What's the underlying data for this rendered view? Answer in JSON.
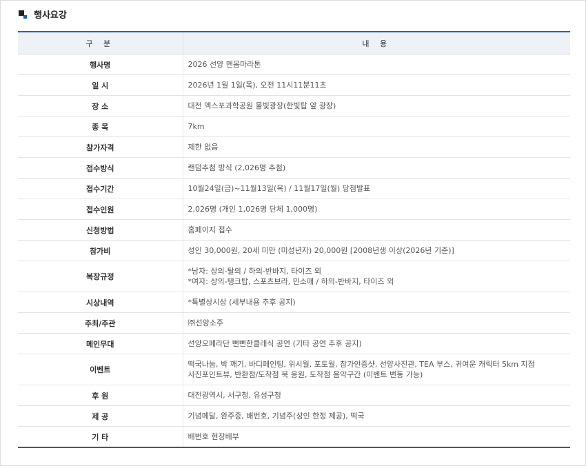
{
  "section": {
    "title": "행사요강"
  },
  "table": {
    "headers": [
      "구 분",
      "내 용"
    ],
    "rows": [
      {
        "label": "행사명",
        "value": [
          "2026 선양 맨몸마라톤"
        ]
      },
      {
        "label": "일 시",
        "value": [
          "2026년 1월 1일(목), 오전 11시11분11초"
        ]
      },
      {
        "label": "장 소",
        "value": [
          "대전 엑스포과학공원 물빛광장(한빛탑 앞 광장)"
        ]
      },
      {
        "label": "종 목",
        "value": [
          "7km"
        ]
      },
      {
        "label": "참가자격",
        "value": [
          "제한 없음"
        ]
      },
      {
        "label": "접수방식",
        "value": [
          "랜덤추첨 방식 (2,026명 추첨)"
        ]
      },
      {
        "label": "접수기간",
        "value": [
          "10월24일(금)~11월13일(목) / 11월17일(월) 당첨발표"
        ]
      },
      {
        "label": "접수인원",
        "value": [
          "2,026명 (개인 1,026명 단체 1,000명)"
        ]
      },
      {
        "label": "신청방법",
        "value": [
          "홈페이지 접수"
        ]
      },
      {
        "label": "참가비",
        "value": [
          "성인 30,000원, 20세 미만 (미성년자) 20,000원 [2008년생 이상(2026년 기준)]"
        ]
      },
      {
        "label": "복장규정",
        "value": [
          "*남자: 상의-탈의 / 하의-반바지, 타이즈 외",
          "*여자: 상의-탱크탑, 스포츠브라, 민소매 / 하의-반바지, 타이즈 외"
        ]
      },
      {
        "label": "시상내역",
        "value": [
          "*특별상시상 (세부내용 추후 공지)"
        ]
      },
      {
        "label": "주최/주관",
        "value": [
          "㈜선양소주"
        ]
      },
      {
        "label": "메인무대",
        "value": [
          "선양오페라단 뻔뻔한클래식 공연 (기타 공연 추후 공지)"
        ]
      },
      {
        "label": "이벤트",
        "value": [
          "떡국나눔, 박 깨기, 바디페인팅, 위시월, 포토월, 참가인증샷, 선양사진관, TEA 부스, 귀여운 캐릭터 5km 지점",
          "사진포인트뷰, 반환점/도착점 북 응원, 도착점 음악구간 (이벤트 변동 가능)"
        ]
      },
      {
        "label": "후 원",
        "value": [
          "대전광역시, 서구청, 유성구청"
        ]
      },
      {
        "label": "제 공",
        "value": [
          "기념메달, 완주증, 배번호, 기념주(성인 한정 제공), 떡국"
        ]
      },
      {
        "label": "기 타",
        "value": [
          "배번호 현장배부"
        ]
      }
    ]
  }
}
